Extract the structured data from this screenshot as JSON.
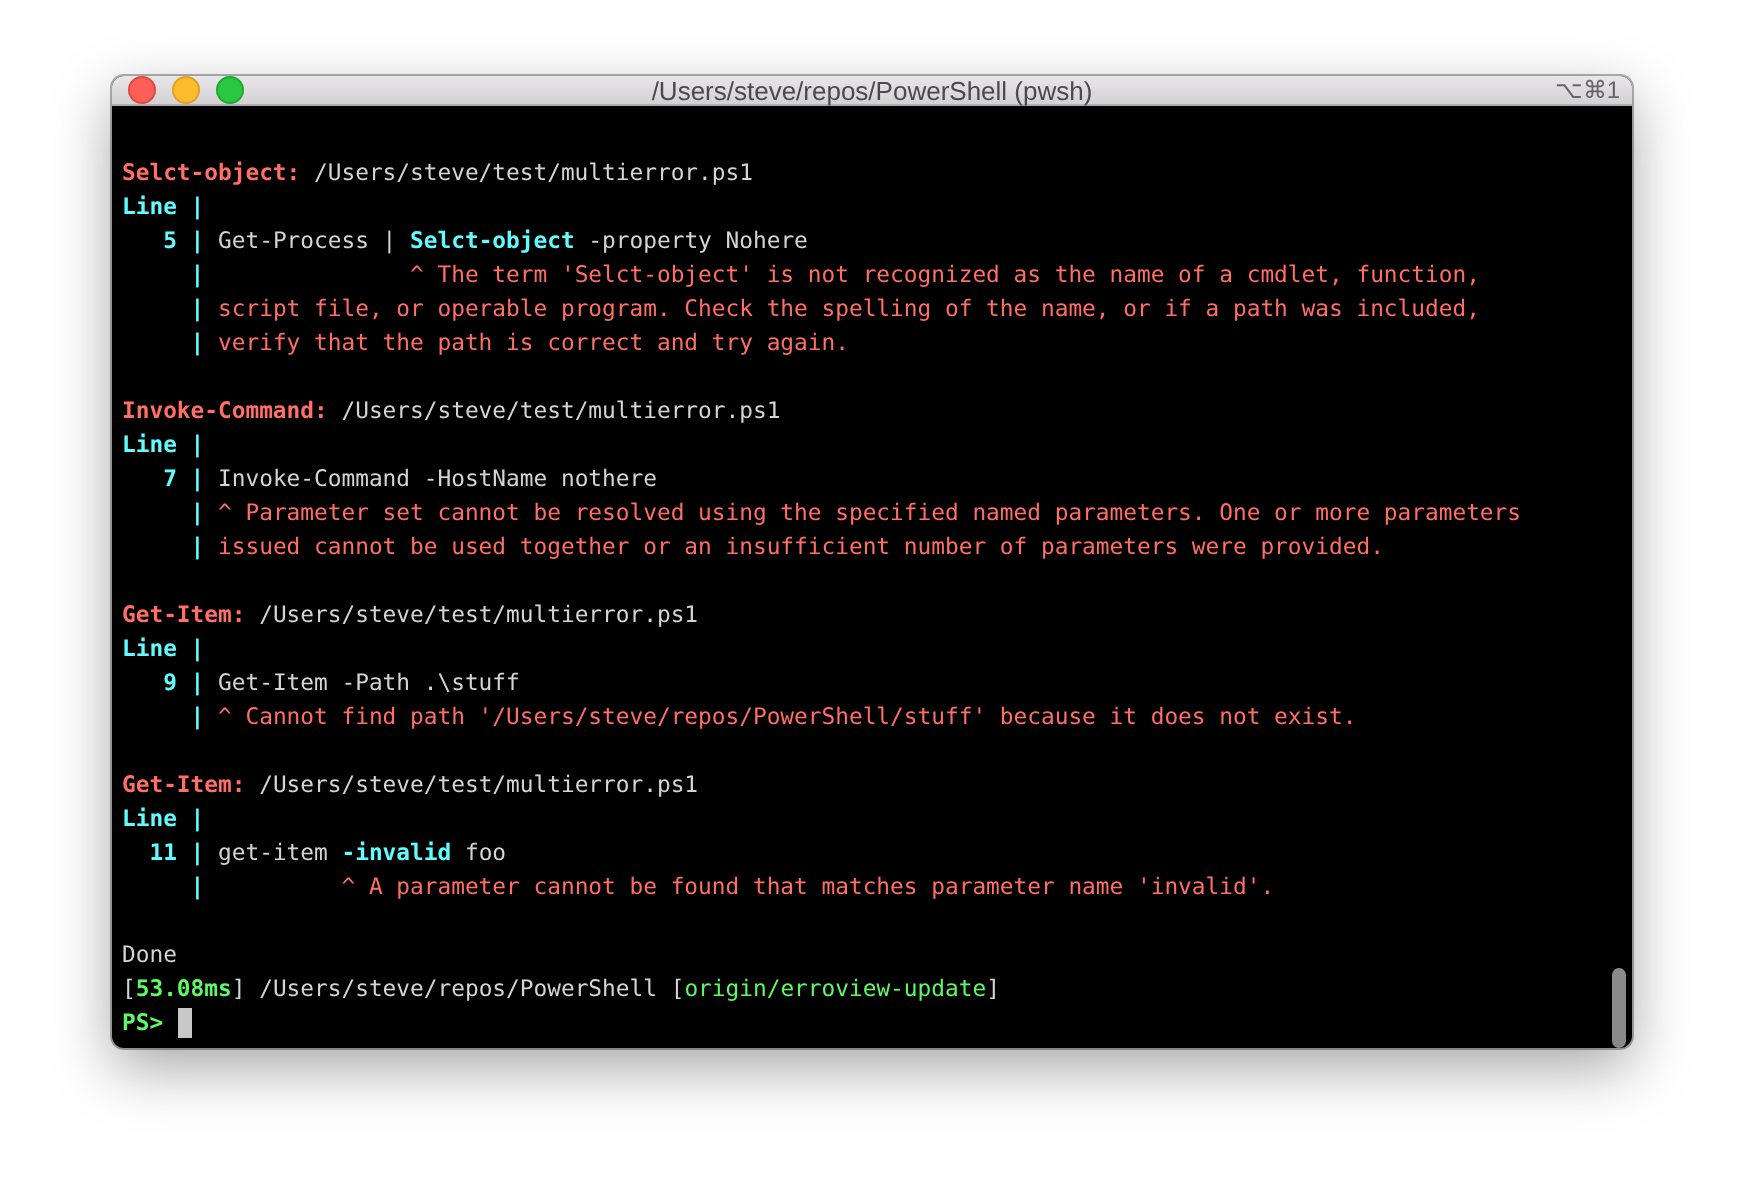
{
  "window": {
    "title": "/Users/steve/repos/PowerShell (pwsh)",
    "shortcut": "⌥⌘1"
  },
  "lines": [
    {
      "kind": "blank"
    },
    {
      "kind": "text",
      "segments": [
        {
          "text": "Selct-object:",
          "kind": "label"
        },
        {
          "text": " /Users/steve/test/multierror.ps1",
          "kind": "plain"
        }
      ]
    },
    {
      "kind": "text",
      "segments": [
        {
          "text": "Line |",
          "kind": "accent"
        }
      ]
    },
    {
      "kind": "text",
      "segments": [
        {
          "text": "   5 |",
          "kind": "accent"
        },
        {
          "text": " Get-Process | ",
          "kind": "plain"
        },
        {
          "text": "Selct-object",
          "kind": "accent"
        },
        {
          "text": " -property Nohere",
          "kind": "plain"
        }
      ]
    },
    {
      "kind": "text",
      "segments": [
        {
          "text": "     |",
          "kind": "accent"
        },
        {
          "text": "               ^ The term 'Selct-object' is not recognized as the name of a cmdlet, function,",
          "kind": "error"
        }
      ]
    },
    {
      "kind": "text",
      "segments": [
        {
          "text": "     |",
          "kind": "accent"
        },
        {
          "text": " script file, or operable program. Check the spelling of the name, or if a path was included,",
          "kind": "error"
        }
      ]
    },
    {
      "kind": "text",
      "segments": [
        {
          "text": "     |",
          "kind": "accent"
        },
        {
          "text": " verify that the path is correct and try again.",
          "kind": "error"
        }
      ]
    },
    {
      "kind": "blank"
    },
    {
      "kind": "text",
      "segments": [
        {
          "text": "Invoke-Command:",
          "kind": "label"
        },
        {
          "text": " /Users/steve/test/multierror.ps1",
          "kind": "plain"
        }
      ]
    },
    {
      "kind": "text",
      "segments": [
        {
          "text": "Line |",
          "kind": "accent"
        }
      ]
    },
    {
      "kind": "text",
      "segments": [
        {
          "text": "   7 |",
          "kind": "accent"
        },
        {
          "text": " Invoke-Command -HostName nothere",
          "kind": "plain"
        }
      ]
    },
    {
      "kind": "text",
      "segments": [
        {
          "text": "     |",
          "kind": "accent"
        },
        {
          "text": " ^ Parameter set cannot be resolved using the specified named parameters. One or more parameters",
          "kind": "error"
        }
      ]
    },
    {
      "kind": "text",
      "segments": [
        {
          "text": "     |",
          "kind": "accent"
        },
        {
          "text": " issued cannot be used together or an insufficient number of parameters were provided.",
          "kind": "error"
        }
      ]
    },
    {
      "kind": "blank"
    },
    {
      "kind": "text",
      "segments": [
        {
          "text": "Get-Item:",
          "kind": "label"
        },
        {
          "text": " /Users/steve/test/multierror.ps1",
          "kind": "plain"
        }
      ]
    },
    {
      "kind": "text",
      "segments": [
        {
          "text": "Line |",
          "kind": "accent"
        }
      ]
    },
    {
      "kind": "text",
      "segments": [
        {
          "text": "   9 |",
          "kind": "accent"
        },
        {
          "text": " Get-Item -Path .\\stuff",
          "kind": "plain"
        }
      ]
    },
    {
      "kind": "text",
      "segments": [
        {
          "text": "     |",
          "kind": "accent"
        },
        {
          "text": " ^ Cannot find path '/Users/steve/repos/PowerShell/stuff' because it does not exist.",
          "kind": "error"
        }
      ]
    },
    {
      "kind": "blank"
    },
    {
      "kind": "text",
      "segments": [
        {
          "text": "Get-Item:",
          "kind": "label"
        },
        {
          "text": " /Users/steve/test/multierror.ps1",
          "kind": "plain"
        }
      ]
    },
    {
      "kind": "text",
      "segments": [
        {
          "text": "Line |",
          "kind": "accent"
        }
      ]
    },
    {
      "kind": "text",
      "segments": [
        {
          "text": "  11 |",
          "kind": "accent"
        },
        {
          "text": " get-item ",
          "kind": "plain"
        },
        {
          "text": "-invalid",
          "kind": "accent"
        },
        {
          "text": " foo",
          "kind": "plain"
        }
      ]
    },
    {
      "kind": "text",
      "segments": [
        {
          "text": "     |",
          "kind": "accent"
        },
        {
          "text": "          ^ A parameter cannot be found that matches parameter name 'invalid'.",
          "kind": "error"
        }
      ]
    },
    {
      "kind": "blank"
    },
    {
      "kind": "text",
      "segments": [
        {
          "text": "Done",
          "kind": "plain"
        }
      ]
    },
    {
      "kind": "text",
      "segments": [
        {
          "text": "[",
          "kind": "plain"
        },
        {
          "text": "53.08ms",
          "kind": "time"
        },
        {
          "text": "] /Users/steve/repos/PowerShell [",
          "kind": "plain"
        },
        {
          "text": "origin/erroview-update",
          "kind": "branch"
        },
        {
          "text": "]",
          "kind": "plain"
        }
      ]
    },
    {
      "kind": "prompt",
      "segments": [
        {
          "text": "PS>",
          "kind": "time"
        }
      ]
    }
  ]
}
